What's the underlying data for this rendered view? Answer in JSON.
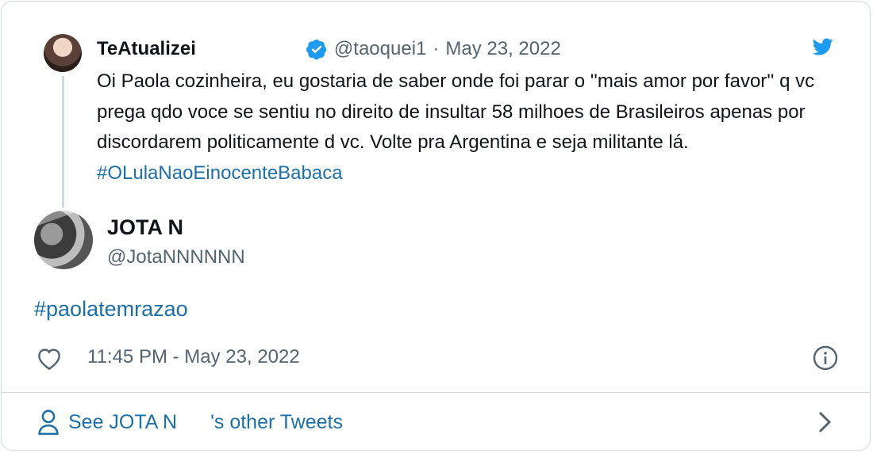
{
  "parent_tweet": {
    "name": "TeAtualizei",
    "handle": "@taoquei1",
    "separator": "·",
    "date": "May 23, 2022",
    "text": "Oi Paola cozinheira, eu gostaria de saber onde foi parar o ''mais amor por favor'' q vc prega qdo voce se sentiu no direito de insultar 58 milhoes de Brasileiros apenas por discordarem politicamente d vc. Volte pra Argentina e seja militante lá. ",
    "hashtag": "#OLulaNaoEinocenteBabaca"
  },
  "tweet": {
    "author_name": "JOTA N",
    "author_handle": "@JotaNNNNNN",
    "text": "#paolatemrazao",
    "timestamp": "11:45 PM - May 23, 2022"
  },
  "footer": {
    "see_label": "See JOTA N",
    "other_label": "'s other Tweets"
  },
  "colors": {
    "link": "#1d6fa8",
    "twitter_blue": "#1d9bf0",
    "muted": "#536471",
    "border": "#cfd9de"
  },
  "icons": [
    "twitter-logo-icon",
    "verified-badge-icon",
    "heart-icon",
    "info-icon",
    "person-icon",
    "chevron-right-icon"
  ]
}
